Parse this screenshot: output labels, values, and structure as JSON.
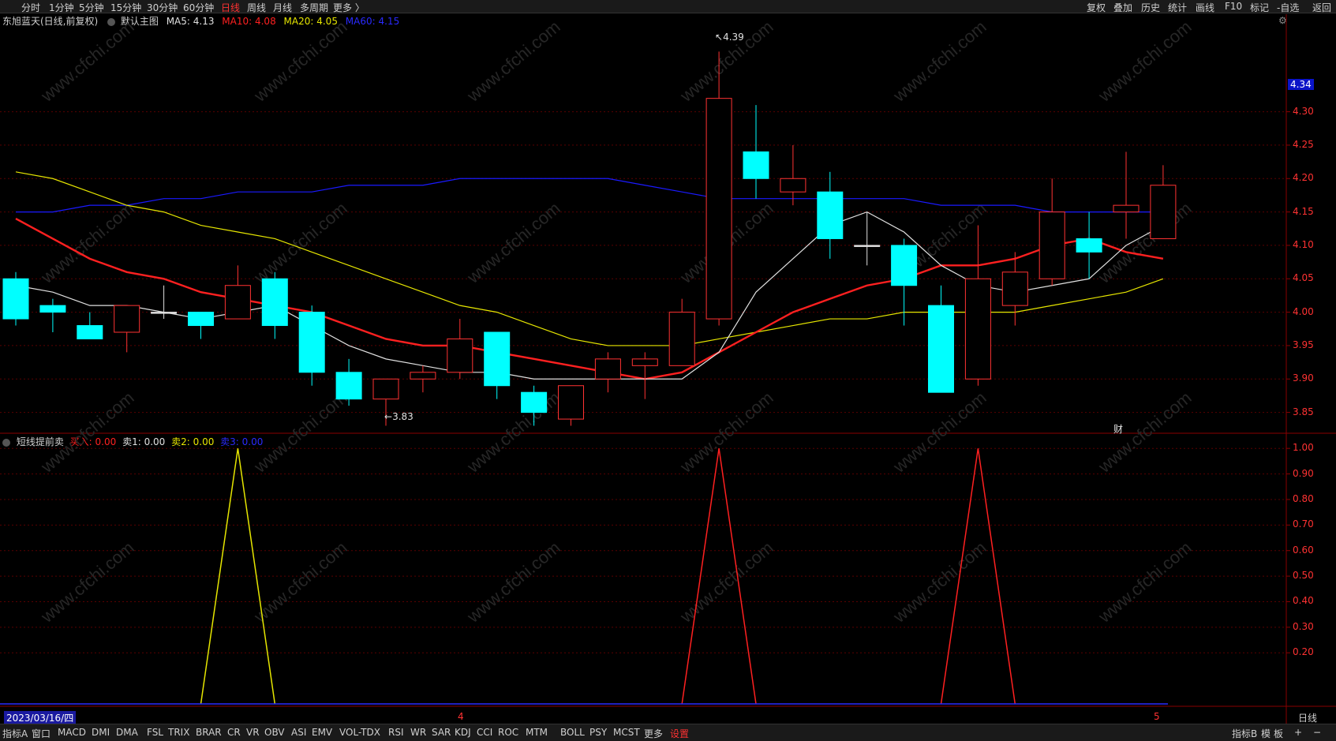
{
  "top_menu": {
    "left": [
      "分时",
      "1分钟",
      "5分钟",
      "15分钟",
      "30分钟",
      "60分钟",
      "日线",
      "周线",
      "月线",
      "多周期",
      "更多 〉"
    ],
    "active": "日线",
    "right": [
      "复权",
      "叠加",
      "历史",
      "统计",
      "画线",
      "F10",
      "标记",
      "-自选",
      "返回"
    ]
  },
  "main_header": {
    "stock": "东旭蓝天(日线,前复权)",
    "chart_name": "默认主图",
    "ma5": "MA5: 4.13",
    "ma10": "MA10: 4.08",
    "ma20": "MA20: 4.05",
    "ma60": "MA60: 4.15"
  },
  "sub_header": {
    "indicator": "短线提前卖",
    "buy": "买入: 0.00",
    "sell1": "卖1: 0.00",
    "sell2": "卖2: 0.00",
    "sell3": "卖3: 0.00"
  },
  "annotations": {
    "high": "4.39",
    "low": "3.83",
    "fin_marker": "财"
  },
  "price_axis": {
    "current_label": "4.34",
    "ticks": [
      "4.30",
      "4.25",
      "4.20",
      "4.15",
      "4.10",
      "4.05",
      "4.00",
      "3.95",
      "3.90",
      "3.85"
    ]
  },
  "sub_axis": {
    "ticks": [
      "1.00",
      "0.90",
      "0.80",
      "0.70",
      "0.60",
      "0.50",
      "0.40",
      "0.30",
      "0.20"
    ]
  },
  "date_axis": {
    "start_date": "2023/03/16/四",
    "month_4": "4",
    "month_5": "5",
    "period_label": "日线"
  },
  "bottom_tabs": [
    "指标A",
    "窗口",
    "MACD",
    "DMI",
    "DMA",
    "FSL",
    "TRIX",
    "BRAR",
    "CR",
    "VR",
    "OBV",
    "ASI",
    "EMV",
    "VOL-TDX",
    "RSI",
    "WR",
    "SAR",
    "KDJ",
    "CCI",
    "ROC",
    "MTM",
    "BOLL",
    "PSY",
    "MCST",
    "更多",
    "设置"
  ],
  "bottom_right": [
    "指标B",
    "模",
    "板",
    "+",
    "−"
  ],
  "watermark": "www.cfchi.com",
  "colors": {
    "up": "#ff3232",
    "down": "#00ffff",
    "ma5": "#e0e0e0",
    "ma10": "#ff2020",
    "ma20": "#e6e600",
    "ma60": "#1a1aff",
    "grid": "#5a0000",
    "axis_text": "#ff3232"
  },
  "chart_data": {
    "type": "candlestick",
    "ylim": [
      3.82,
      4.42
    ],
    "candles": [
      {
        "o": 4.05,
        "h": 4.06,
        "l": 3.98,
        "c": 3.99
      },
      {
        "o": 4.01,
        "h": 4.02,
        "l": 3.97,
        "c": 4.0
      },
      {
        "o": 3.98,
        "h": 4.0,
        "l": 3.96,
        "c": 3.96
      },
      {
        "o": 3.97,
        "h": 4.01,
        "l": 3.94,
        "c": 4.01
      },
      {
        "o": 4.0,
        "h": 4.04,
        "l": 3.99,
        "c": 4.0
      },
      {
        "o": 4.0,
        "h": 4.0,
        "l": 3.96,
        "c": 3.98
      },
      {
        "o": 3.99,
        "h": 4.07,
        "l": 3.99,
        "c": 4.04
      },
      {
        "o": 4.05,
        "h": 4.06,
        "l": 3.96,
        "c": 3.98
      },
      {
        "o": 4.0,
        "h": 4.01,
        "l": 3.89,
        "c": 3.91
      },
      {
        "o": 3.91,
        "h": 3.93,
        "l": 3.86,
        "c": 3.87
      },
      {
        "o": 3.87,
        "h": 3.9,
        "l": 3.83,
        "c": 3.9
      },
      {
        "o": 3.9,
        "h": 3.92,
        "l": 3.88,
        "c": 3.91
      },
      {
        "o": 3.91,
        "h": 3.99,
        "l": 3.9,
        "c": 3.96
      },
      {
        "o": 3.97,
        "h": 3.97,
        "l": 3.87,
        "c": 3.89
      },
      {
        "o": 3.88,
        "h": 3.89,
        "l": 3.83,
        "c": 3.85
      },
      {
        "o": 3.84,
        "h": 3.89,
        "l": 3.83,
        "c": 3.89
      },
      {
        "o": 3.9,
        "h": 3.94,
        "l": 3.88,
        "c": 3.93
      },
      {
        "o": 3.92,
        "h": 3.94,
        "l": 3.87,
        "c": 3.93
      },
      {
        "o": 3.92,
        "h": 4.02,
        "l": 3.92,
        "c": 4.0
      },
      {
        "o": 3.99,
        "h": 4.39,
        "l": 3.98,
        "c": 4.32
      },
      {
        "o": 4.24,
        "h": 4.31,
        "l": 4.17,
        "c": 4.2
      },
      {
        "o": 4.18,
        "h": 4.25,
        "l": 4.16,
        "c": 4.2
      },
      {
        "o": 4.18,
        "h": 4.21,
        "l": 4.08,
        "c": 4.11
      },
      {
        "o": 4.1,
        "h": 4.15,
        "l": 4.07,
        "c": 4.1
      },
      {
        "o": 4.1,
        "h": 4.11,
        "l": 3.98,
        "c": 4.04
      },
      {
        "o": 4.01,
        "h": 4.04,
        "l": 3.88,
        "c": 3.88
      },
      {
        "o": 3.9,
        "h": 4.13,
        "l": 3.89,
        "c": 4.05
      },
      {
        "o": 4.01,
        "h": 4.09,
        "l": 3.98,
        "c": 4.06
      },
      {
        "o": 4.05,
        "h": 4.2,
        "l": 4.04,
        "c": 4.15
      },
      {
        "o": 4.11,
        "h": 4.15,
        "l": 4.05,
        "c": 4.09
      },
      {
        "o": 4.15,
        "h": 4.24,
        "l": 4.11,
        "c": 4.16
      },
      {
        "o": 4.11,
        "h": 4.22,
        "l": 4.11,
        "c": 4.19
      }
    ],
    "ma5": [
      4.04,
      4.03,
      4.01,
      4.01,
      4.0,
      3.99,
      4.0,
      4.01,
      3.98,
      3.95,
      3.93,
      3.92,
      3.91,
      3.91,
      3.9,
      3.9,
      3.9,
      3.9,
      3.9,
      3.94,
      4.03,
      4.08,
      4.13,
      4.15,
      4.12,
      4.07,
      4.04,
      4.03,
      4.04,
      4.05,
      4.1,
      4.13
    ],
    "ma10": [
      4.14,
      4.11,
      4.08,
      4.06,
      4.05,
      4.03,
      4.02,
      4.01,
      4.0,
      3.98,
      3.96,
      3.95,
      3.95,
      3.94,
      3.93,
      3.92,
      3.91,
      3.9,
      3.91,
      3.94,
      3.97,
      4.0,
      4.02,
      4.04,
      4.05,
      4.07,
      4.07,
      4.08,
      4.1,
      4.11,
      4.09,
      4.08
    ],
    "ma20": [
      4.21,
      4.2,
      4.18,
      4.16,
      4.15,
      4.13,
      4.12,
      4.11,
      4.09,
      4.07,
      4.05,
      4.03,
      4.01,
      4.0,
      3.98,
      3.96,
      3.95,
      3.95,
      3.95,
      3.96,
      3.97,
      3.98,
      3.99,
      3.99,
      4.0,
      4.0,
      4.0,
      4.0,
      4.01,
      4.02,
      4.03,
      4.05
    ],
    "ma60": [
      4.15,
      4.15,
      4.16,
      4.16,
      4.17,
      4.17,
      4.18,
      4.18,
      4.18,
      4.19,
      4.19,
      4.19,
      4.2,
      4.2,
      4.2,
      4.2,
      4.2,
      4.19,
      4.18,
      4.17,
      4.17,
      4.17,
      4.17,
      4.17,
      4.17,
      4.16,
      4.16,
      4.16,
      4.15,
      4.15,
      4.15,
      4.15
    ],
    "signals": {
      "sell2": [
        0,
        0,
        0,
        0,
        0,
        0,
        1,
        0,
        0,
        0,
        0,
        0,
        0,
        0,
        0,
        0,
        0,
        0,
        0,
        0,
        0,
        0,
        0,
        0,
        0,
        0,
        0,
        0,
        0,
        0,
        0,
        0
      ],
      "buy": [
        0,
        0,
        0,
        0,
        0,
        0,
        0,
        0,
        0,
        0,
        0,
        0,
        0,
        0,
        0,
        0,
        0,
        0,
        0,
        1,
        0,
        0,
        0,
        0,
        0,
        0,
        1,
        0,
        0,
        0,
        0,
        0
      ]
    },
    "signal_ylim": [
      0,
      1.05
    ]
  }
}
